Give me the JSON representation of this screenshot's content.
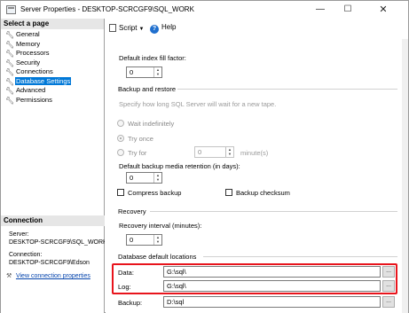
{
  "window": {
    "title": "Server Properties - DESKTOP-SCRCGF9\\SQL_WORK",
    "minimize": "—",
    "maximize": "☐",
    "close": "✕"
  },
  "left_pane": {
    "header": "Select a page",
    "pages": [
      {
        "label": "General",
        "selected": false
      },
      {
        "label": "Memory",
        "selected": false
      },
      {
        "label": "Processors",
        "selected": false
      },
      {
        "label": "Security",
        "selected": false
      },
      {
        "label": "Connections",
        "selected": false
      },
      {
        "label": "Database Settings",
        "selected": true
      },
      {
        "label": "Advanced",
        "selected": false
      },
      {
        "label": "Permissions",
        "selected": false
      }
    ],
    "connection": {
      "header": "Connection",
      "server_label": "Server:",
      "server_value": "DESKTOP-SCRCGF9\\SQL_WORK",
      "connection_label": "Connection:",
      "connection_value": "DESKTOP-SCRCGF9\\Edson",
      "link": "View connection properties"
    }
  },
  "toolbar": {
    "script_label": "Script",
    "help_label": "Help",
    "help_glyph": "?"
  },
  "form": {
    "fill_factor_label": "Default index fill factor:",
    "fill_factor_value": "0",
    "backup_restore_section": "Backup and restore",
    "tape_prompt": "Specify how long SQL Server will wait for a new tape.",
    "wait_indefinitely": "Wait indefinitely",
    "try_once": "Try once",
    "try_for": "Try for",
    "try_for_value": "0",
    "minutes_unit": "minute(s)",
    "retention_label": "Default backup media retention (in days):",
    "retention_value": "0",
    "compress_backup": "Compress backup",
    "backup_checksum": "Backup checksum",
    "recovery_section": "Recovery",
    "recovery_interval_label": "Recovery interval (minutes):",
    "recovery_interval_value": "0",
    "locations_section": "Database default locations",
    "data_label": "Data:",
    "data_value": "G:\\sql\\",
    "log_label": "Log:",
    "log_value": "G:\\sql\\",
    "backup_label": "Backup:",
    "backup_value": "D:\\sql",
    "browse_glyph": "..."
  },
  "colors": {
    "selection": "#0078d7",
    "highlight_border": "#e8141c",
    "link": "#0645ad"
  }
}
